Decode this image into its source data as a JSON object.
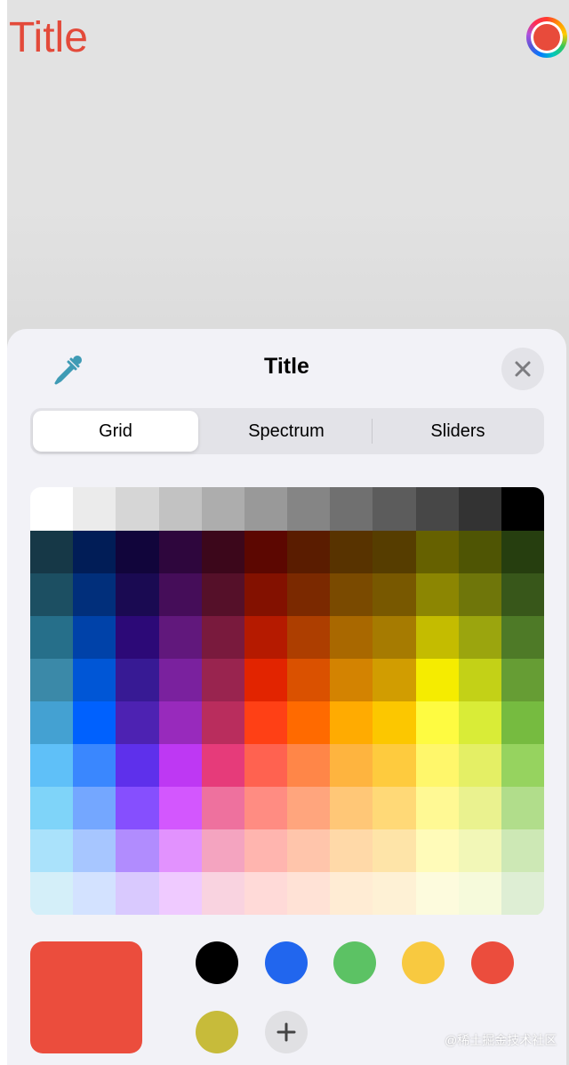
{
  "page": {
    "title": "Title",
    "title_color": "#e34a3a",
    "current_color": "#e84b3b"
  },
  "sheet": {
    "title": "Title",
    "eyedropper_icon": "eyedropper-icon",
    "close_icon": "close-icon",
    "tabs": [
      {
        "label": "Grid",
        "selected": true
      },
      {
        "label": "Spectrum",
        "selected": false
      },
      {
        "label": "Sliders",
        "selected": false
      }
    ]
  },
  "grid_colors": [
    [
      "#ffffff",
      "#ebebeb",
      "#d6d6d6",
      "#c2c2c2",
      "#adadad",
      "#999999",
      "#858585",
      "#707070",
      "#5c5c5c",
      "#474747",
      "#333333",
      "#000000"
    ],
    [
      "#163847",
      "#011d57",
      "#11053b",
      "#2e063d",
      "#3c071b",
      "#5c0701",
      "#5a1c00",
      "#583300",
      "#563d00",
      "#666100",
      "#4f5504",
      "#263e0f"
    ],
    [
      "#1c4f62",
      "#012f7b",
      "#1a0a52",
      "#450d59",
      "#551029",
      "#831100",
      "#7b2900",
      "#7a4a00",
      "#785800",
      "#8c8602",
      "#6f760a",
      "#38571a"
    ],
    [
      "#266f8a",
      "#0042a9",
      "#2c0977",
      "#61187c",
      "#791a3d",
      "#b51a00",
      "#ad3e00",
      "#a96800",
      "#a67b01",
      "#c4bc00",
      "#9ba50e",
      "#4e7a27"
    ],
    [
      "#3b89a8",
      "#0056d6",
      "#371a94",
      "#7a219e",
      "#99244f",
      "#e22400",
      "#da5100",
      "#d38301",
      "#d19d01",
      "#f5ec00",
      "#c3d117",
      "#669d34"
    ],
    [
      "#44a1d2",
      "#0061fe",
      "#4d22b2",
      "#982abc",
      "#b92d5d",
      "#ff4015",
      "#ff6a00",
      "#ffab01",
      "#fcc700",
      "#fefb41",
      "#d9ec37",
      "#76bb40"
    ],
    [
      "#5fc0f8",
      "#3a87fe",
      "#5e30eb",
      "#be38f3",
      "#e63b7a",
      "#ff6250",
      "#ff8648",
      "#feb43f",
      "#fecb3e",
      "#fff76b",
      "#e4ef65",
      "#96d35f"
    ],
    [
      "#7fd4f9",
      "#74a7ff",
      "#864ffe",
      "#d357fe",
      "#ee719e",
      "#ff8c82",
      "#ffa57d",
      "#ffc777",
      "#ffd977",
      "#fff994",
      "#eaf28f",
      "#b1dd8b"
    ],
    [
      "#aae2fb",
      "#a7c6ff",
      "#b18cfe",
      "#e292fe",
      "#f4a4c0",
      "#ffb5af",
      "#ffc5ab",
      "#ffd9a8",
      "#fee4a8",
      "#fffbb9",
      "#f2f7b7",
      "#cde8b5"
    ],
    [
      "#d4eff9",
      "#d3e2ff",
      "#d9c9fe",
      "#efcaff",
      "#f9d3e0",
      "#ffdad8",
      "#ffe2d6",
      "#ffecd4",
      "#fef1d5",
      "#fdfbdd",
      "#f6fadb",
      "#deeed4"
    ]
  ],
  "current_swatch": "#eb4d3d",
  "saved_swatches": [
    {
      "name": "swatch-black",
      "color": "#000000"
    },
    {
      "name": "swatch-blue",
      "color": "#2166ee"
    },
    {
      "name": "swatch-green",
      "color": "#5cc264"
    },
    {
      "name": "swatch-yellow",
      "color": "#f8c940"
    },
    {
      "name": "swatch-red",
      "color": "#eb4d3d"
    },
    {
      "name": "swatch-olive",
      "color": "#c7bb3a"
    }
  ],
  "add_icon": "plus-icon",
  "watermark": "@稀土掘金技术社区"
}
